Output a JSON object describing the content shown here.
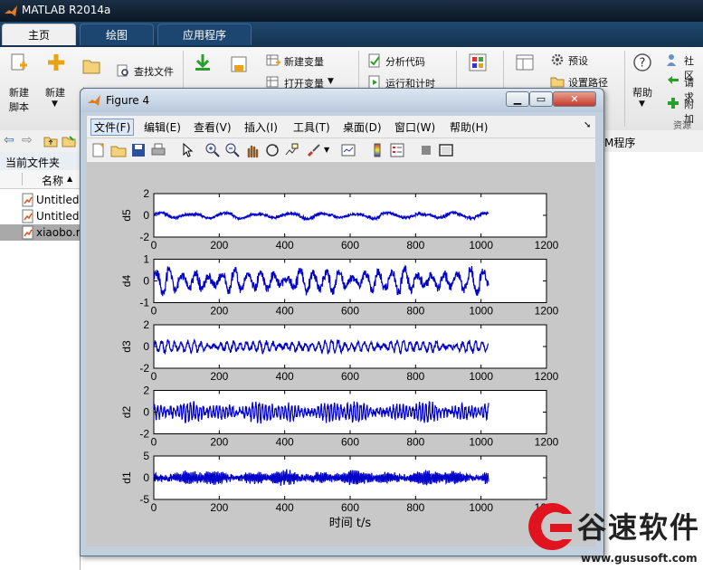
{
  "app": {
    "title": "MATLAB R2014a"
  },
  "tabs": [
    {
      "label": "主页",
      "active": true
    },
    {
      "label": "绘图",
      "active": false
    },
    {
      "label": "应用程序",
      "active": false
    }
  ],
  "ribbon": {
    "new_script": [
      "新建",
      "脚本"
    ],
    "new": "新建",
    "open": "打开",
    "find_files": "查找文件",
    "new_variable": "新建变量",
    "open_variable": "打开变量",
    "analyze_code": "分析代码",
    "run_and_time": "运行和计时",
    "preferences": "预设",
    "set_path": "设置路径",
    "help": "帮助",
    "community": "社区",
    "request_support": "请求",
    "add_ons": "附加",
    "resources": "资源"
  },
  "addr": {
    "path_tail": "M程序"
  },
  "files": {
    "panel_title": "当前文件夹",
    "column_name": "名称",
    "items": [
      "Untitled.",
      "Untitled",
      "xiaobo.r"
    ]
  },
  "figure": {
    "title": "Figure 4",
    "menus": [
      "文件(F)",
      "编辑(E)",
      "查看(V)",
      "插入(I)",
      "工具(T)",
      "桌面(D)",
      "窗口(W)",
      "帮助(H)"
    ],
    "xlabel": "时间 t/s"
  },
  "chart_data": [
    {
      "type": "line",
      "ylabel": "d5",
      "xlim": [
        0,
        1200
      ],
      "ylim": [
        -2,
        2
      ],
      "yticks": [
        "2",
        "0",
        "-2"
      ],
      "xticks": [
        "0",
        "200",
        "400",
        "600",
        "800",
        "1000",
        "1200"
      ],
      "color": "#0000cc",
      "n_points": 1024,
      "amplitude": 0.35
    },
    {
      "type": "line",
      "ylabel": "d4",
      "xlim": [
        0,
        1200
      ],
      "ylim": [
        -1,
        1
      ],
      "yticks": [
        "1",
        "0",
        "-1"
      ],
      "xticks": [
        "0",
        "200",
        "400",
        "600",
        "800",
        "1000",
        "1200"
      ],
      "color": "#0000cc",
      "n_points": 1024,
      "amplitude": 0.6
    },
    {
      "type": "line",
      "ylabel": "d3",
      "xlim": [
        0,
        1200
      ],
      "ylim": [
        -2,
        2
      ],
      "yticks": [
        "2",
        "0",
        "-2"
      ],
      "xticks": [
        "0",
        "200",
        "400",
        "600",
        "800",
        "1000",
        "1200"
      ],
      "color": "#0000cc",
      "n_points": 1024,
      "amplitude": 0.6
    },
    {
      "type": "line",
      "ylabel": "d2",
      "xlim": [
        0,
        1200
      ],
      "ylim": [
        -2,
        2
      ],
      "yticks": [
        "2",
        "0",
        "-2"
      ],
      "xticks": [
        "0",
        "200",
        "400",
        "600",
        "800",
        "1000",
        "1200"
      ],
      "color": "#0000cc",
      "n_points": 1024,
      "amplitude": 0.9
    },
    {
      "type": "line",
      "ylabel": "d1",
      "xlim": [
        0,
        1200
      ],
      "ylim": [
        -5,
        5
      ],
      "yticks": [
        "5",
        "0",
        "-5"
      ],
      "xticks": [
        "0",
        "200",
        "400",
        "600",
        "800",
        "1000",
        "1200"
      ],
      "color": "#0000cc",
      "n_points": 1024,
      "amplitude": 1.6
    }
  ],
  "watermark": {
    "brand": "谷速软件",
    "url": "www.gususoft.com",
    "colors": {
      "red": "#e0141e",
      "dark": "#222222"
    }
  }
}
